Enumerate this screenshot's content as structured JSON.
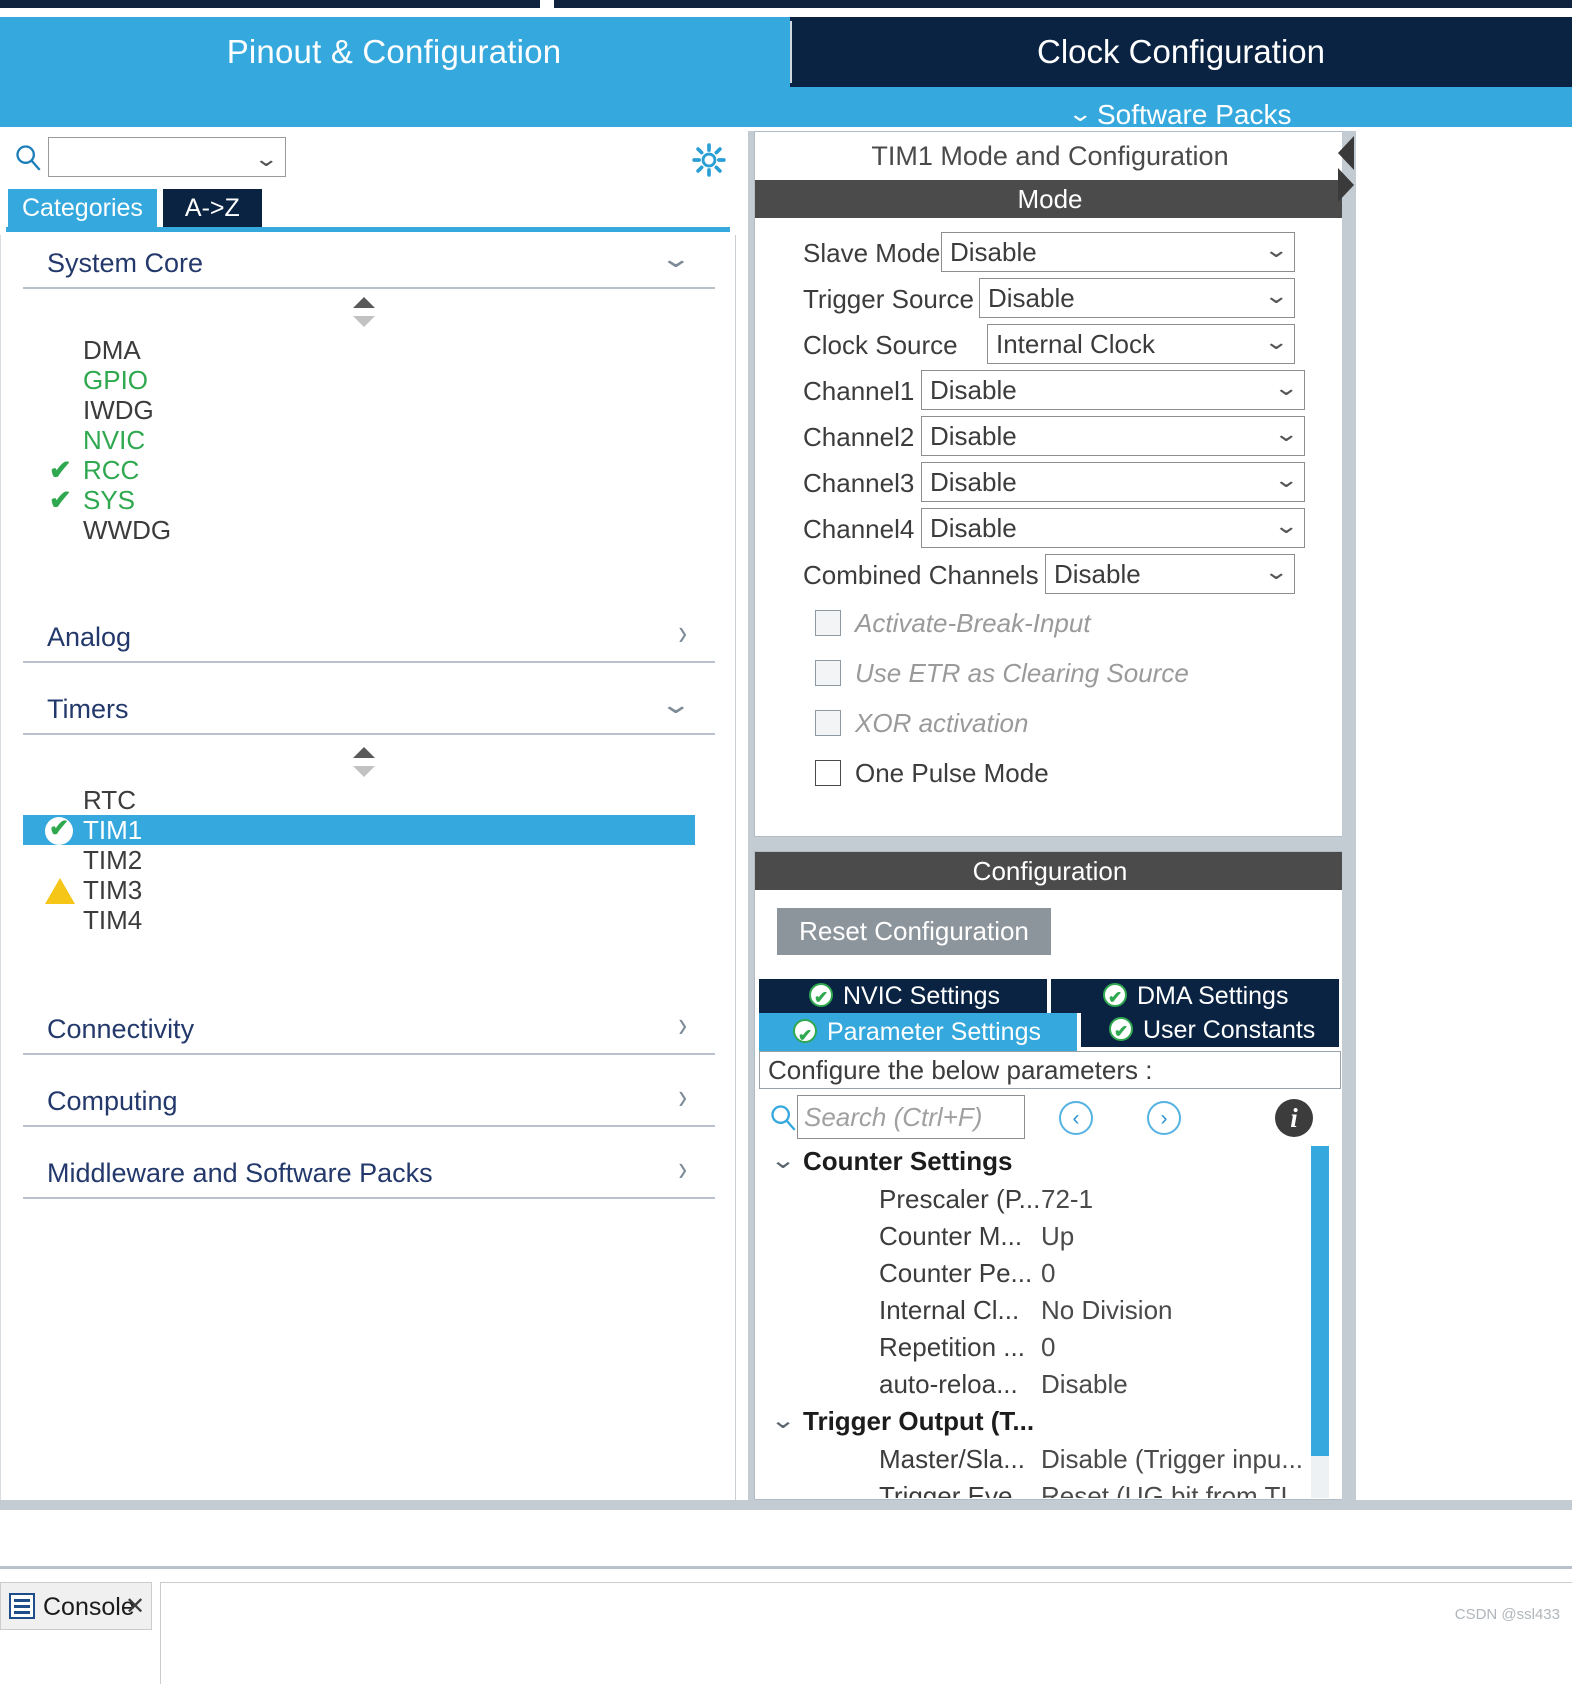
{
  "tabs": {
    "pinout": "Pinout & Configuration",
    "clock": "Clock Configuration",
    "software_packs": "Software Packs"
  },
  "left_panel": {
    "search_placeholder": "",
    "search_value": "",
    "segments": {
      "categories": "Categories",
      "az": "A->Z"
    },
    "categories": [
      {
        "label": "System Core",
        "expanded": true,
        "items": [
          {
            "label": "DMA",
            "state": "none",
            "color": "default"
          },
          {
            "label": "GPIO",
            "state": "none",
            "color": "green"
          },
          {
            "label": "IWDG",
            "state": "none",
            "color": "default"
          },
          {
            "label": "NVIC",
            "state": "none",
            "color": "green"
          },
          {
            "label": "RCC",
            "state": "check",
            "color": "green"
          },
          {
            "label": "SYS",
            "state": "check",
            "color": "green"
          },
          {
            "label": "WWDG",
            "state": "none",
            "color": "default"
          }
        ]
      },
      {
        "label": "Analog",
        "expanded": false,
        "items": []
      },
      {
        "label": "Timers",
        "expanded": true,
        "items": [
          {
            "label": "RTC",
            "state": "none",
            "color": "default"
          },
          {
            "label": "TIM1",
            "state": "badge",
            "color": "default",
            "selected": true
          },
          {
            "label": "TIM2",
            "state": "none",
            "color": "default"
          },
          {
            "label": "TIM3",
            "state": "warn",
            "color": "default"
          },
          {
            "label": "TIM4",
            "state": "none",
            "color": "default"
          }
        ]
      },
      {
        "label": "Connectivity",
        "expanded": false,
        "items": []
      },
      {
        "label": "Computing",
        "expanded": false,
        "items": []
      },
      {
        "label": "Middleware and Software Packs",
        "expanded": false,
        "items": []
      }
    ]
  },
  "right_panel": {
    "peripheral_title": "TIM1 Mode and Configuration",
    "mode_header": "Mode",
    "mode_rows": [
      {
        "label": "Slave Mode",
        "value": "Disable"
      },
      {
        "label": "Trigger Source",
        "value": "Disable"
      },
      {
        "label": "Clock Source",
        "value": "Internal Clock"
      },
      {
        "label": "Channel1",
        "value": "Disable"
      },
      {
        "label": "Channel2",
        "value": "Disable"
      },
      {
        "label": "Channel3",
        "value": "Disable"
      },
      {
        "label": "Channel4",
        "value": "Disable"
      },
      {
        "label": "Combined Channels",
        "value": "Disable"
      }
    ],
    "mode_checkboxes": [
      {
        "label": "Activate-Break-Input",
        "checked": false,
        "disabled": true
      },
      {
        "label": "Use ETR as Clearing Source",
        "checked": false,
        "disabled": true
      },
      {
        "label": "XOR activation",
        "checked": false,
        "disabled": true
      },
      {
        "label": "One Pulse Mode",
        "checked": false,
        "disabled": false
      }
    ],
    "configuration": {
      "header": "Configuration",
      "reset_button": "Reset Configuration",
      "tabs": [
        {
          "label": "NVIC Settings",
          "active": false
        },
        {
          "label": "DMA Settings",
          "active": false
        },
        {
          "label": "Parameter Settings",
          "active": true
        },
        {
          "label": "User Constants",
          "active": false
        }
      ],
      "configure_bar": "Configure the below parameters :",
      "param_search_placeholder": "Search (Ctrl+F)",
      "param_search_value": "",
      "groups": [
        {
          "label": "Counter Settings",
          "expanded": true,
          "rows": [
            {
              "key": "Prescaler (P...",
              "value": "72-1"
            },
            {
              "key": "Counter M...",
              "value": "Up"
            },
            {
              "key": "Counter Pe...",
              "value": "0"
            },
            {
              "key": "Internal Cl...",
              "value": "No Division"
            },
            {
              "key": "Repetition ...",
              "value": "0"
            },
            {
              "key": "auto-reloa...",
              "value": "Disable"
            }
          ]
        },
        {
          "label": "Trigger Output (T...",
          "expanded": true,
          "rows": [
            {
              "key": "Master/Sla...",
              "value": "Disable (Trigger inpu..."
            },
            {
              "key": "Trigger Eve...",
              "value": "Reset (UG bit from TI..."
            }
          ]
        }
      ]
    }
  },
  "bottom": {
    "console_label": "Console",
    "console_close": "✕",
    "watermark": "CSDN @ssl433"
  },
  "colors": {
    "accent": "#35a8dd",
    "dark_navy": "#0a2342",
    "header_gray": "#4b4b4b",
    "green": "#2fa84f",
    "warn": "#f5c518"
  }
}
